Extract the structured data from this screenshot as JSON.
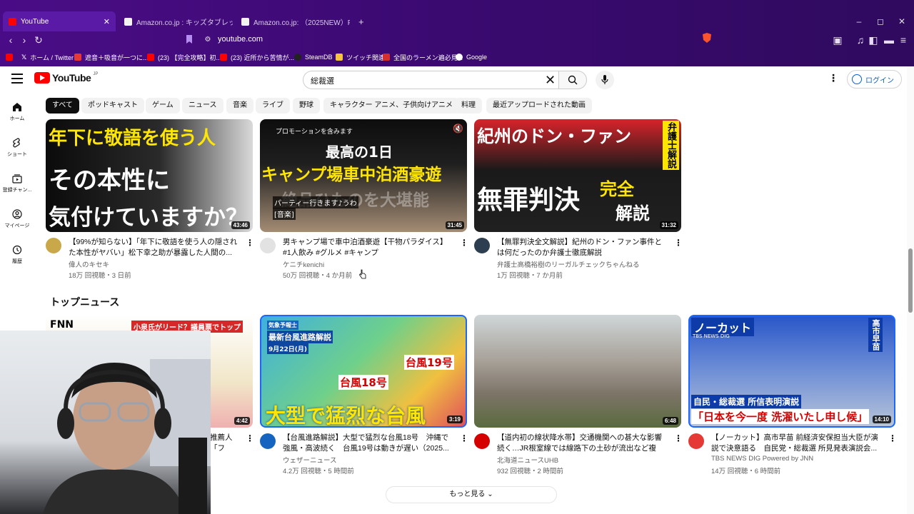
{
  "browser": {
    "tabs": [
      {
        "title": "YouTube",
        "close": "✕",
        "active": true
      },
      {
        "title": "Amazon.co.jp : キッズタブレット"
      },
      {
        "title": "Amazon.co.jp: （2025NEW）PlimPed"
      }
    ],
    "new_tab": "+",
    "url": "youtube.com",
    "bookmarks": [
      "ホーム / Twitter",
      "遮音＋吸音が一つに...",
      "(23) 【完全攻略】初...",
      "(23) 近所から苦情が...",
      "SteamDB",
      "ツイッチ関連",
      "全国のラーメン遍必見...",
      "Google"
    ],
    "window_controls": {
      "minimize": "–",
      "maximize": "◻",
      "close": "✕"
    },
    "shield_badge": "31"
  },
  "youtube": {
    "logo_text": "YouTube",
    "logo_country": "JP",
    "search": {
      "value": "総裁選"
    },
    "login_label": "ログイン",
    "more_icon": "⋮",
    "guide": [
      {
        "label": "ホーム",
        "icon": "home-icon"
      },
      {
        "label": "ショート",
        "icon": "shorts-icon"
      },
      {
        "label": "登録チャン...",
        "icon": "subscriptions-icon"
      },
      {
        "label": "マイページ",
        "icon": "you-icon"
      },
      {
        "label": "履歴",
        "icon": "history-icon"
      }
    ],
    "chips": [
      "すべて",
      "ポッドキャスト",
      "ゲーム",
      "ニュース",
      "音楽",
      "ライブ",
      "野球",
      "キャラクター アニメ、子供向けアニメ",
      "料理",
      "最近アップロードされた動画"
    ],
    "row1": [
      {
        "thumb_lines": [
          "年下に敬語を使う人",
          "その本性に",
          "気付けていますか？"
        ],
        "duration": "43:46",
        "title": "【99%が知らない】「年下に敬語を使う人の隠された本性がヤバい」松下幸之助が暴露した人間の...",
        "channel": "偉人のキセキ",
        "meta": "18万 回視聴・3 日前"
      },
      {
        "promo": "プロモーションを含みます",
        "thumb_lines": [
          "最高の1日",
          "キャンプ場車中泊酒豪遊",
          "絶品ひものを大堪能"
        ],
        "caption": "パーティー行きます♪うわ",
        "caption2": "[音楽]",
        "duration": "31:45",
        "title": "男キャンプ場で車中泊酒豪遊【干物パラダイス】#1人飲み #グルメ #キャンプ",
        "channel": "ケニチkenichi",
        "meta": "50万 回視聴・4 か月前"
      },
      {
        "thumb_lines": [
          "紀州のドン・ファン",
          "無罪判決",
          "完全",
          "解説",
          "弁護士解説"
        ],
        "duration": "31:32",
        "title": "【無罪判決全文解説】紀州のドン・ファン事件とは何だったのか弁護士徹底解説",
        "channel": "弁護士高橋裕樹のリーガルチェックちゃんねる",
        "meta": "1万 回視聴・7 か月前"
      }
    ],
    "shelf_title": "トップニュース",
    "row2": [
      {
        "thumb_lines": [
          "FNN",
          "小泉氏がリード？議員票でトップ"
        ],
        "duration": "4:42",
        "title": "推薦人「フリ...",
        "channel": "",
        "meta": ""
      },
      {
        "thumb_lines": [
          "気象予報士",
          "最新台風進路解説",
          "9月22日(月)",
          "台風19号",
          "台風18号",
          "大型で猛烈な台風"
        ],
        "duration": "3:19",
        "title": "【台風進路解説】大型で猛烈な台風18号　沖縄で強風・高波続く　台風19号は動きが遅い（2025...",
        "channel": "ウェザーニュース",
        "meta": "4.2万 回視聴・5 時間前"
      },
      {
        "thumb_lines": [],
        "duration": "6:48",
        "title": "【道内初の線状降水帯】交通機関への甚大な影響続く…JR根室線では線路下の土砂が流出など複数...",
        "channel": "北海道ニュースUHB",
        "meta": "932 回視聴・2 時間前"
      },
      {
        "thumb_lines": [
          "ノーカット",
          "TBS NEWS DIG",
          "高市早苗",
          "自民・総裁選 所信表明演説",
          "「日本を今一度 洗濯いたし申し候」"
        ],
        "duration": "14:10",
        "title": "【ノーカット】高市早苗 前経済安保担当大臣が演説で決意語る　自民党・総裁選 所見発表演説会...",
        "channel": "TBS NEWS DIG Powered by JNN",
        "meta": "14万 回視聴・6 時間前"
      }
    ],
    "show_more": "もっと見る"
  }
}
